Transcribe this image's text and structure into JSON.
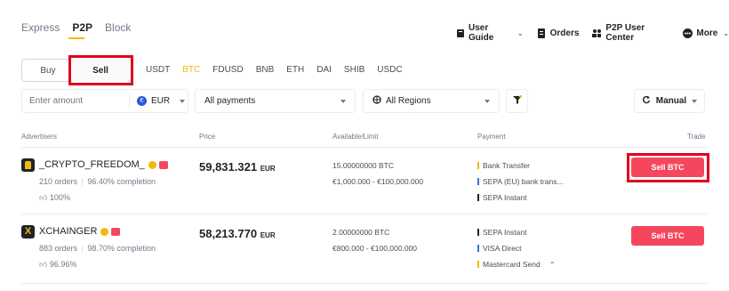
{
  "tabs": [
    "Express",
    "P2P",
    "Block"
  ],
  "topnav": {
    "user_guide": "User Guide",
    "orders": "Orders",
    "p2p_user_center": "P2P User Center",
    "more": "More"
  },
  "trade_type": {
    "buy": "Buy",
    "sell": "Sell",
    "selected": "Sell"
  },
  "coins": [
    "USDT",
    "BTC",
    "FDUSD",
    "BNB",
    "ETH",
    "DAI",
    "SHIB",
    "USDC"
  ],
  "selected_coin": "BTC",
  "filters": {
    "amount_placeholder": "Enter amount",
    "currency": "EUR",
    "payments": "All payments",
    "regions": "All Regions",
    "sort": "Manual"
  },
  "table": {
    "headers": [
      "Advertisers",
      "Price",
      "Available/Limit",
      "Payment",
      "Trade"
    ],
    "rows": [
      {
        "name": "_CRYPTO_FREEDOM_",
        "orders": "210 orders",
        "completion": "96.40% completion",
        "rating": "100%",
        "price": "59,831.321",
        "price_currency": "EUR",
        "available": "15.00000000 BTC",
        "limit": "€1,000.000 - €100,000.000",
        "payments": [
          "Bank Transfer",
          "SEPA (EU) bank trans...",
          "SEPA Instant"
        ],
        "payment_colors": [
          "#f0b90b",
          "#3a6fd8",
          "#1e2329"
        ],
        "trade": "Sell BTC"
      },
      {
        "name": "XCHAINGER",
        "orders": "883 orders",
        "completion": "98.70% completion",
        "rating": "96.96%",
        "price": "58,213.770",
        "price_currency": "EUR",
        "available": "2.00000000 BTC",
        "limit": "€800.000 - €100,000.000",
        "payments": [
          "SEPA Instant",
          "VISA Direct",
          "Mastercard Send"
        ],
        "payment_colors": [
          "#1e2329",
          "#3a6fd8",
          "#f0b90b"
        ],
        "trade": "Sell BTC"
      }
    ]
  },
  "colors": {
    "accent": "#f0b90b",
    "sell": "#f6465d",
    "highlight": "#e0001b"
  }
}
